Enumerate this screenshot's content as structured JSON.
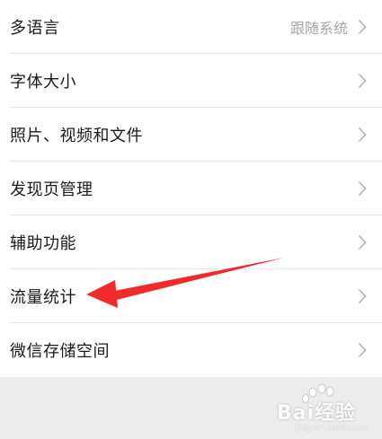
{
  "settings": {
    "items": [
      {
        "label": "多语言",
        "value": "跟随系统"
      },
      {
        "label": "字体大小"
      },
      {
        "label": "照片、视频和文件"
      },
      {
        "label": "发现页管理"
      },
      {
        "label": "辅助功能"
      },
      {
        "label": "流量统计"
      },
      {
        "label": "微信存储空间"
      }
    ]
  },
  "annotation": {
    "arrow_color": "#f02b2b",
    "points_to": "流量统计"
  },
  "watermark": {
    "brand": "Bai",
    "brand_cn": "经验",
    "sub": "jingyan.baidu.com"
  },
  "colors": {
    "background": "#ededed",
    "row_bg": "#ffffff",
    "text": "#1a1a1a",
    "secondary_text": "#a5a5a5",
    "chevron": "#b2b2b2"
  }
}
